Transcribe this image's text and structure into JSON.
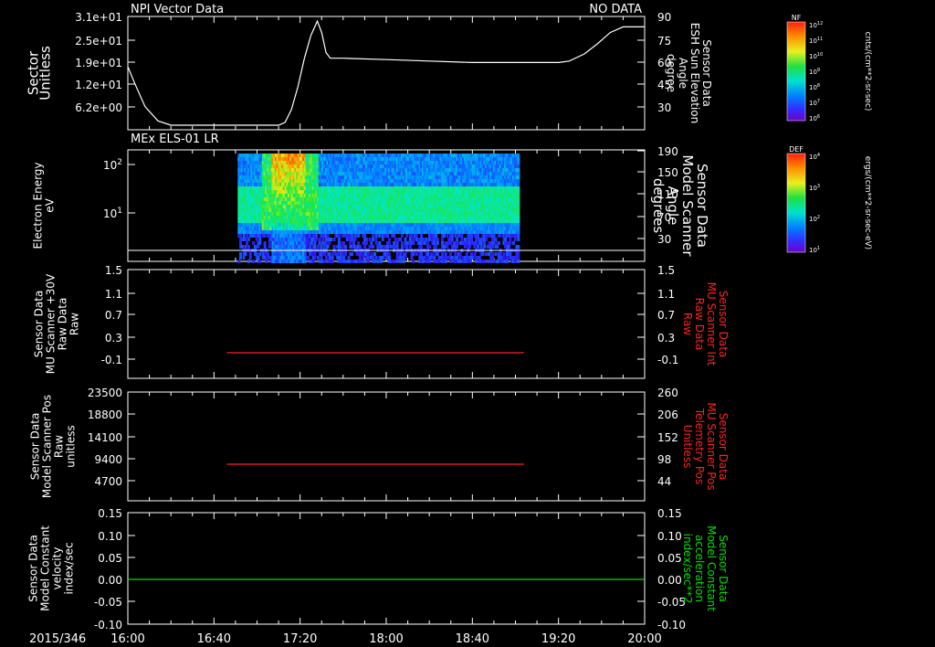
{
  "header": {
    "left_title": "NPI Vector Data",
    "right_title": "NO DATA"
  },
  "colors": {
    "foreground": "#ffffff",
    "red_trace": "#ff2020",
    "green_trace": "#00e000",
    "background": "#000000"
  },
  "time_axis": {
    "date": "2015/346",
    "tick_labels": [
      "16:00",
      "16:40",
      "17:20",
      "18:00",
      "18:40",
      "19:20",
      "20:00"
    ]
  },
  "colorbars": [
    {
      "label": "NF",
      "unit": "cnts/(cm**2-sr-sec)",
      "tick_labels": [
        "10^12",
        "10^11",
        "10^10",
        "10^9",
        "10^8",
        "10^7",
        "10^6"
      ]
    },
    {
      "label": "DEF",
      "unit": "ergs/(cm**2-sr-sec-eV)",
      "tick_labels": [
        "10^4",
        "10^3",
        "10^2",
        "10^1"
      ]
    }
  ],
  "panels": [
    {
      "id": "p1",
      "left_label": [
        "Sector",
        "Unitless"
      ],
      "left_ticks": [
        "3.1e+01",
        "2.5e+01",
        "1.9e+01",
        "1.2e+01",
        "6.2e+00"
      ],
      "right_label": [
        "Sensor Data",
        "ESH Sun Elevation",
        "Angle",
        "degree"
      ],
      "right_ticks": [
        "90",
        "75",
        "60",
        "45",
        "30"
      ]
    },
    {
      "id": "p2",
      "title": "MEx ELS-01 LR",
      "left_label": [
        "Electron Energy",
        "eV"
      ],
      "left_ticks": [
        "10^2",
        "10^1"
      ],
      "right_label": [
        "Sensor Data",
        "Model Scanner",
        "Angle",
        "degrees"
      ],
      "right_ticks": [
        "190",
        "150",
        "110",
        "70",
        "30"
      ]
    },
    {
      "id": "p3",
      "left_label": [
        "Sensor Data",
        "MU Scanner +30V",
        "Raw Data",
        "Raw"
      ],
      "left_ticks": [
        "1.5",
        "1.1",
        "0.7",
        "0.3",
        "-0.1"
      ],
      "right_label": [
        "Sensor Data",
        "MU Scanner Int",
        "Raw Data",
        "Raw"
      ],
      "right_ticks": [
        "1.5",
        "1.1",
        "0.7",
        "0.3",
        "-0.1"
      ]
    },
    {
      "id": "p4",
      "left_label": [
        "Sensor Data",
        "Model Scanner Pos",
        "Raw",
        "unitless"
      ],
      "left_ticks": [
        "23500",
        "18800",
        "14100",
        "9400",
        "4700"
      ],
      "right_label": [
        "Sensor Data",
        "MU Scanner Pos",
        "Telemetry Pos",
        "Unitless"
      ],
      "right_ticks": [
        "260",
        "206",
        "152",
        "98",
        "44"
      ]
    },
    {
      "id": "p5",
      "left_label": [
        "Sensor Data",
        "Model Constant",
        "velocity",
        "index/sec"
      ],
      "left_ticks": [
        "0.15",
        "0.10",
        "0.05",
        "0.00",
        "-0.05",
        "-0.10"
      ],
      "right_label": [
        "Sensor Data",
        "Model Constant",
        "acceleration",
        "index/sec**2"
      ],
      "right_ticks": [
        "0.15",
        "0.10",
        "0.05",
        "0.00",
        "-0.05",
        "-0.10"
      ]
    }
  ],
  "chart_data": [
    {
      "type": "line",
      "panel": "p1",
      "x_unit": "minutes after 16:00",
      "xlim": [
        0,
        240
      ],
      "ylim": [
        15,
        90
      ],
      "y_scale": "right axis, degree",
      "series": [
        {
          "x": [
            0,
            3,
            8,
            14,
            20,
            26,
            40,
            60,
            70,
            73,
            76,
            79,
            82,
            85,
            88,
            90,
            92,
            94,
            100,
            120,
            140,
            160,
            180,
            190,
            200,
            205,
            212,
            218,
            224,
            230,
            236,
            240
          ],
          "y": [
            56,
            45,
            28,
            18,
            15,
            15,
            15,
            15,
            15,
            17,
            26,
            42,
            62,
            78,
            88,
            80,
            66,
            62,
            62,
            61,
            60,
            59,
            59,
            59,
            59,
            60,
            65,
            72,
            80,
            84,
            84,
            84
          ]
        }
      ]
    },
    {
      "type": "heatmap",
      "panel": "p2",
      "x_unit": "minutes after 16:00",
      "xlim": [
        0,
        240
      ],
      "x_range": [
        51,
        181
      ],
      "ylim_log10": [
        0.2,
        2.3
      ],
      "y_range_log10": [
        0.25,
        2.25
      ],
      "colorbar": "DEF",
      "colorscale_log10": [
        1,
        4
      ],
      "structure": "burst of high flux at 17:07-17:20 across ~10-200 eV, band of moderate flux between ~5-20 eV persisting to ~19:15",
      "baseline_log10": 0.4
    },
    {
      "type": "line",
      "panel": "p3",
      "color": "red",
      "xlim": [
        0,
        240
      ],
      "ylim": [
        -0.35,
        1.5
      ],
      "series": [
        {
          "x": [
            46,
            184
          ],
          "y": [
            0,
            0
          ]
        }
      ]
    },
    {
      "type": "line",
      "panel": "p4",
      "color": "red",
      "xlim": [
        0,
        240
      ],
      "ylim": [
        0,
        23500
      ],
      "series": [
        {
          "x": [
            46,
            184
          ],
          "y": [
            7900,
            7900
          ]
        }
      ]
    },
    {
      "type": "line",
      "panel": "p5",
      "color": "green",
      "xlim": [
        0,
        240
      ],
      "ylim": [
        -0.1,
        0.15
      ],
      "series": [
        {
          "x": [
            0,
            240
          ],
          "y": [
            0,
            0
          ]
        }
      ]
    }
  ]
}
